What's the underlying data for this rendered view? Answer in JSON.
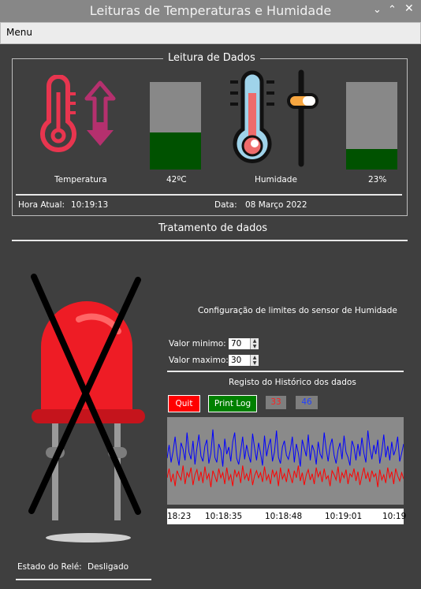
{
  "window": {
    "title": "Leituras de Temperaturas e Humidade",
    "controls": [
      "chevron-down-icon",
      "chevron-up-icon",
      "close-icon"
    ]
  },
  "menu": {
    "label": "Menu"
  },
  "readings": {
    "title": "Leitura de Dados",
    "temperature": {
      "label": "Temperatura",
      "value": "42ºC",
      "level": 0.42
    },
    "humidity": {
      "label": "Humidade",
      "value": "23%",
      "level": 0.23
    },
    "time_label": "Hora Atual:",
    "time_value": "10:19:13",
    "date_label": "Data:",
    "date_value": "08 Março 2022"
  },
  "processing": {
    "title": "Tratamento de dados"
  },
  "relay": {
    "label": "Estado do Relé:",
    "value": "Desligado"
  },
  "limits": {
    "title": "Configuração de limites do sensor de Humidade",
    "min_label": "Valor minimo:",
    "min_value": "70",
    "max_label": "Valor maximo:",
    "max_value": "30"
  },
  "history": {
    "title": "Registo do Histórico dos dados",
    "quit_label": "Quit",
    "printlog_label": "Print Log",
    "temp_badge": "33",
    "hum_badge": "46"
  },
  "colors": {
    "quit_button": "#ff0000",
    "printlog_button": "#008000",
    "temperature_series": "#ff0000",
    "humidity_series": "#0000ff",
    "bar_fill": "#005200",
    "bar_empty": "#888888"
  },
  "chart_data": {
    "type": "line",
    "x_ticks": [
      "18:23",
      "10:18:35",
      "10:18:48",
      "10:19:01",
      "10:19"
    ],
    "series": [
      {
        "color": "#0000ff",
        "values": [
          45,
          58,
          41,
          52,
          66,
          48,
          38,
          60,
          54,
          43,
          70,
          51,
          44,
          62,
          39,
          55,
          68,
          47,
          42,
          57,
          63,
          40,
          50,
          73,
          46,
          41,
          59,
          53,
          37,
          64,
          49,
          56,
          42,
          61,
          70,
          45,
          39,
          52,
          66,
          44,
          58,
          48,
          41,
          69,
          55,
          43,
          60,
          50,
          38,
          67,
          47,
          57,
          64,
          42,
          51,
          72,
          46,
          40,
          56,
          62,
          48,
          44,
          53,
          66,
          41,
          59,
          50,
          37,
          63,
          55,
          47,
          68,
          43,
          58,
          52,
          39,
          61,
          49,
          45,
          70,
          54,
          42,
          57,
          64,
          48,
          40,
          53,
          60,
          44,
          67,
          51,
          46,
          38,
          62,
          56,
          43,
          59,
          47,
          65,
          50,
          41,
          72,
          55,
          44,
          58,
          49,
          63,
          40,
          52,
          68,
          46,
          57,
          43,
          61,
          48,
          54,
          66,
          42,
          50,
          59
        ]
      },
      {
        "color": "#ff0000",
        "values": [
          26,
          35,
          22,
          30,
          18,
          33,
          28,
          24,
          38,
          20,
          31,
          27,
          36,
          19,
          29,
          34,
          23,
          32,
          21,
          37,
          25,
          30,
          17,
          33,
          28,
          22,
          35,
          26,
          31,
          20,
          36,
          24,
          29,
          18,
          34,
          27,
          32,
          21,
          38,
          25,
          30,
          23,
          35,
          19,
          28,
          33,
          26,
          31,
          22,
          37,
          24,
          29,
          20,
          34,
          27,
          32,
          18,
          36,
          25,
          30,
          22,
          35,
          28,
          21,
          33,
          26,
          38,
          23,
          31,
          19,
          29,
          34,
          24,
          30,
          20,
          36,
          27,
          32,
          22,
          35,
          25,
          28,
          18,
          33,
          29,
          24,
          37,
          21,
          31,
          26,
          34,
          20,
          30,
          27,
          35,
          23,
          32,
          19,
          28,
          36,
          25,
          31,
          22,
          33,
          27,
          30,
          17,
          34,
          24,
          29,
          21,
          36,
          26,
          32,
          20,
          35,
          28,
          23,
          31,
          25
        ]
      }
    ]
  }
}
